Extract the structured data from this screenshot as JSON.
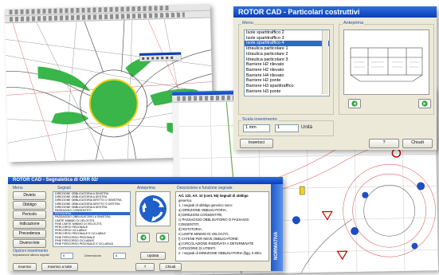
{
  "window_cad": {
    "menubar": "",
    "title": ""
  },
  "window_detail": {
    "title": "ROTOR CAD - Particolari costruttivi",
    "menu_group_label": "Menu",
    "preview_group_label": "Anteprima",
    "list_items": [
      "Isole spartitraffico 2",
      "Isole spartitraffico 3",
      "Isole spartitraffico 4",
      "Idraulica particolare 1",
      "Idraulica particolare 2",
      "Idraulica particolare 3",
      "Barriere H2 rilevato",
      "Barriere H2 rilevato",
      "Barriere H4 rilevato",
      "Barriere H2 ponte",
      "Barriere H3 spartitraffico",
      "Barriere H3 ponte"
    ],
    "selected_index": 2,
    "scale_label": "Scala inserimento",
    "scale_unit_select": "1 mm",
    "scale_value": "1",
    "scale_unit_label": "Unità",
    "insert_button": "Inserisci",
    "help_button": "?",
    "close_button": "Chiudi"
  },
  "window_signs": {
    "title": "ROTOR CAD - Segnaletica di ORR 02/",
    "col_menu": "Menu",
    "col_segnali": "Segnali",
    "col_anteprima": "Anteprima",
    "col_descr": "Descrizione e funzione segnale",
    "menu_buttons": [
      "Divieto",
      "Obbligo",
      "Pericolo",
      "Indicazione",
      "Precedenza",
      "Diversi-Inte"
    ],
    "sign_items": [
      "DIREZIONE OBBLIGATORIA A SINISTRA",
      "DIREZIONE OBBLIGATORIA A DESTRA",
      "DIREZIONE OBBLIGATORIA DIRITTO O SINISTRA",
      "DIREZIONE OBBLIGATORIA DIRITTO O DESTRA",
      "DIREZIONE OBBLIGATORIA A DESTRA",
      "PASSAGGIO CONSENTITO",
      "ROTATORIA",
      "PASSAGGIO OBBLIGATORIO A SINISTRA",
      "LIMITE MINIMO DI VELOCITÀ",
      "FINE LIMITE MINIMO DI VELOCITÀ",
      "PERCORSO PEDONALE",
      "PERCORSO CICLABILE",
      "PERCORSO PEDONALE E CICLABILE",
      "FINE PERCORSO PEDONALE",
      "FINE PERCORSO CICLABILE",
      "FINE PERCORSO PEDONALE E CICLABILE"
    ],
    "selected_index": 6,
    "descr_lines": [
      "Art. 122, Art. 10 (cont. 56) Segnali di obbligo",
      "generico.",
      "1. I segnali di obbligo generico sono:",
      "a) DIREZIONE OBBLIGATORIA;",
      "b) DIREZIONI CONSENTITE;",
      "c) PASSAGGIO OBBLIGATORIO O PASSAGGI",
      "CONSENTITI;",
      "d) ROTATORIA;",
      "e) LIMITE MINIMO DI VELOCITÀ;",
      "f) CATENE PER NEVE OBBLIGATORIE;",
      "g) CIRCOLAZIONE RISERVATA A DETERMINATE",
      "CATEGORIE DI UTENTI.",
      "2. I segnali di DIREZIONE OBBLIGATORIA (figg. II.80/a"
    ],
    "insert_group_label": "Opzioni inserimento",
    "ground_label": "Impostazione altezza segnale",
    "ground_value": "0",
    "size_label": "Dimensione",
    "size_value": "0",
    "update_button": "Updata",
    "insert_button": "Inserisci",
    "insert_all_button": "Inserisci a tutte",
    "help_button": "?",
    "close_button": "Chiudi",
    "side_tab": "NORMATIVA"
  },
  "colors": {
    "title_blue": "#0a3fb5",
    "road_green": "#39b54a",
    "ring_yellow": "#f2d21b",
    "side_tab_blue": "#1d58c9"
  }
}
